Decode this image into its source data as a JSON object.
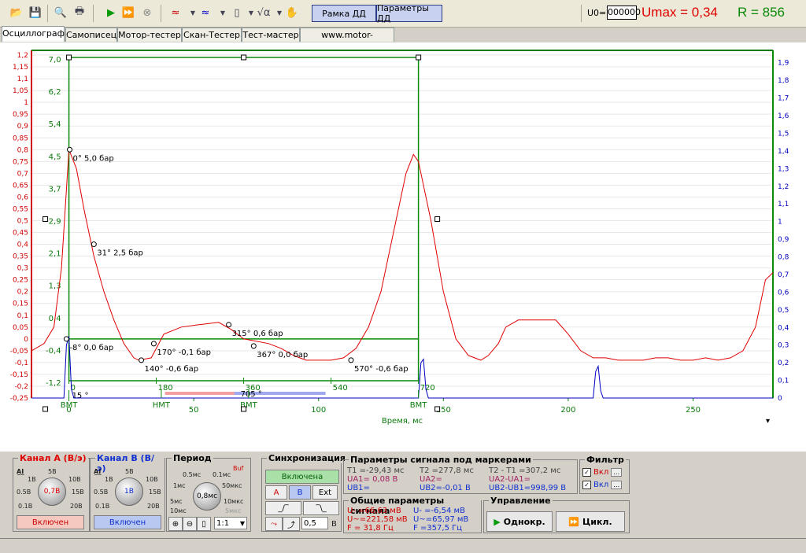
{
  "toolbar": {
    "frame_btn": "Рамка ДД",
    "params_btn": "Параметры ДД",
    "u0_label": "U0=",
    "u0_value": "000000",
    "umax": "Umax = 0,34",
    "r": "R = 856"
  },
  "tabs": [
    "Осциллограф",
    "Самописец",
    "Мотор-тестер",
    "Скан-Тестер",
    "Тест-мастер",
    "www.motor-master.ru"
  ],
  "chart_data": {
    "type": "line",
    "xlabel": "Время, мс",
    "xlim": [
      -15,
      282
    ],
    "x_ticks": [
      0,
      50,
      100,
      150,
      200,
      250
    ],
    "left_axis": {
      "ylim": [
        -0.25,
        1.22
      ],
      "ticks": [
        "-0,25",
        "-0,2",
        "-0,15",
        "-0,1",
        "-0,05",
        "0",
        "0,05",
        "0,1",
        "0,15",
        "0,2",
        "0,25",
        "0,3",
        "0,35",
        "0,4",
        "0,45",
        "0,5",
        "0,55",
        "0,6",
        "0,65",
        "0,7",
        "0,75",
        "0,8",
        "0,85",
        "0,9",
        "0,95",
        "1",
        "1,05",
        "1,1",
        "1,15",
        "1,2"
      ],
      "color": "#d00000"
    },
    "right_axis": {
      "ylim": [
        0,
        1.97
      ],
      "ticks": [
        "0",
        "0,1",
        "0,2",
        "0,3",
        "0,4",
        "0,5",
        "0,6",
        "0,7",
        "0,8",
        "0,9",
        "1",
        "1,1",
        "1,2",
        "1,3",
        "1,4",
        "1,5",
        "1,6",
        "1,7",
        "1,8",
        "1,9"
      ],
      "color": "#0000c0"
    },
    "frame_axis": {
      "ticks": [
        "7,0",
        "6,2",
        "5,4",
        "4,5",
        "3,7",
        "2,9",
        "2,1",
        "1,3",
        "0,4",
        "-0,4",
        "-1,2"
      ],
      "color": "#0a7a0a"
    },
    "frame_x_ticks": [
      "0",
      "180",
      "360",
      "540",
      "720"
    ],
    "marker_labels": [
      "BMT",
      "HMT",
      "BMT",
      "BMT"
    ],
    "frame_extra": [
      "15 °",
      "705 °"
    ],
    "annotations": [
      "0° 5,0 бар",
      "31° 2,5 бар",
      "315° 0,6 бар",
      "-8° 0,0 бар",
      "170° -0,1 бар",
      "367° 0,0 бар",
      "140° -0,6 бар",
      "570° -0,6 бар"
    ],
    "series": [
      {
        "name": "Канал A",
        "color": "#e00000",
        "x": [
          -15,
          -10,
          -6,
          -3,
          0,
          3,
          6,
          10,
          14,
          18,
          22,
          26,
          28,
          33,
          38,
          45,
          52,
          60,
          65,
          70,
          75,
          80,
          85,
          90,
          95,
          100,
          105,
          110,
          115,
          120,
          125,
          130,
          135,
          138,
          140,
          145,
          150,
          155,
          160,
          165,
          168,
          172,
          175,
          180,
          185,
          190,
          195,
          200,
          205,
          210,
          215,
          220,
          225,
          230,
          235,
          240,
          245,
          250,
          255,
          260,
          265,
          270,
          275,
          279,
          282
        ],
        "y": [
          -0.05,
          -0.02,
          0.05,
          0.3,
          0.8,
          0.72,
          0.55,
          0.35,
          0.2,
          0.08,
          -0.02,
          -0.08,
          -0.09,
          -0.08,
          0.02,
          0.05,
          0.06,
          0.07,
          0.04,
          0.0,
          -0.01,
          -0.02,
          -0.04,
          -0.07,
          -0.09,
          -0.09,
          -0.09,
          -0.08,
          -0.04,
          0.05,
          0.2,
          0.45,
          0.7,
          0.78,
          0.75,
          0.5,
          0.2,
          0.0,
          -0.07,
          -0.09,
          -0.07,
          -0.02,
          0.05,
          0.08,
          0.08,
          0.08,
          0.08,
          0.02,
          -0.05,
          -0.08,
          -0.08,
          -0.09,
          -0.09,
          -0.09,
          -0.08,
          -0.08,
          -0.09,
          -0.09,
          -0.08,
          -0.09,
          -0.08,
          -0.05,
          0.05,
          0.25,
          0.28
        ]
      },
      {
        "name": "Канал B",
        "color": "#0000c0",
        "x": [
          -15,
          -2,
          -1,
          0,
          1,
          2,
          140,
          141,
          142,
          143,
          144,
          210,
          211,
          212,
          213,
          214,
          282
        ],
        "y": [
          0,
          0,
          0.3,
          0.35,
          0.05,
          0,
          0,
          0.2,
          0.22,
          0.05,
          0,
          0,
          0.15,
          0.18,
          0.04,
          0,
          0
        ]
      }
    ]
  },
  "channel_a": {
    "title": "Канал А (В/э)",
    "knob": "0,7В",
    "labels": [
      "5В",
      "1В",
      "10В",
      "0.5В",
      "15В",
      "0.1В",
      "20В"
    ],
    "state": "Включен"
  },
  "channel_b": {
    "title": "Канал В (В/э)",
    "knob": "1В",
    "labels": [
      "5В",
      "1В",
      "10В",
      "0.5В",
      "15В",
      "0.1В",
      "20В"
    ],
    "state": "Включен"
  },
  "period": {
    "title": "Период",
    "buf": "Buf",
    "knob": "0,8мс",
    "labels": [
      "0.5мс",
      "0.1мс",
      "1мс",
      "50мкс",
      "5мс",
      "10мкс",
      "10мс",
      "5мкс"
    ],
    "scale": "1:1"
  },
  "sync": {
    "title": "Синхронизация",
    "state": "Включена",
    "sources": [
      "A",
      "B",
      "Ext"
    ],
    "level": "0,5",
    "unit": "В"
  },
  "marker_params": {
    "title": "Параметры сигнала под маркерами",
    "t1": "T1 =-29,43 мс",
    "t2": "T2 =277,8 мс",
    "dt": "T2 - T1 =307,2 мс",
    "ua1": "UA1= 0,08 В",
    "ua2": "UA2=",
    "dua": "UA2-UA1=",
    "ub1": "UB1=",
    "ub2": "UB2=-0,01 В",
    "dub": "UB2-UB1=998,99 В"
  },
  "general_params": {
    "title": "Общие параметры сигнала",
    "a_mean": "U- =66,63 мВ",
    "a_rms": "U~=221,58 мВ",
    "a_freq": "F = 31,8 Гц",
    "b_mean": "U- =-6,54 мВ",
    "b_rms": "U~=65,97 мВ",
    "b_freq": "F =357,5 Гц"
  },
  "filter": {
    "title": "Фильтр",
    "items": [
      "Вкл",
      "Вкл"
    ]
  },
  "control": {
    "title": "Управление",
    "single": "Однокр.",
    "cycle": "Цикл."
  }
}
